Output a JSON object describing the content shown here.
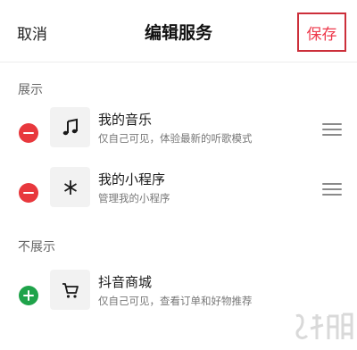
{
  "header": {
    "cancel_label": "取消",
    "title": "编辑服务",
    "save_label": "保存"
  },
  "sections": {
    "shown_label": "展示",
    "hidden_label": "不展示"
  },
  "shown_items": [
    {
      "title": "我的音乐",
      "subtitle": "仅自己可见，体验最新的听歌模式",
      "icon": "music-note-icon"
    },
    {
      "title": "我的小程序",
      "subtitle": "管理我的小程序",
      "icon": "asterisk-icon"
    }
  ],
  "hidden_items": [
    {
      "title": "抖音商城",
      "subtitle": "仅自己可见，查看订单和好物推荐",
      "icon": "shopping-cart-icon"
    }
  ],
  "colors": {
    "remove": "#e8383d",
    "add": "#1fa34a",
    "save_text": "#ee3a4c",
    "highlight_box": "#cc2f3a"
  }
}
